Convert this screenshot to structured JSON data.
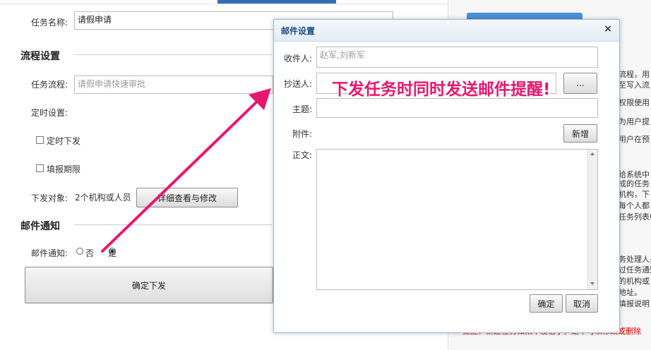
{
  "form": {
    "task_name_label": "任务名称:",
    "task_name_value": "请假申请",
    "process_section": "流程设置",
    "flow_label": "任务流程:",
    "flow_value": "请假申请快速审批",
    "timer_label": "定时设置:",
    "timed_dispatch_label": "定时下发",
    "deadline_label": "填报期限",
    "target_label": "下发对象:",
    "target_value": "2个机构或人员",
    "detail_button": "详细查看与修改",
    "email_section": "邮件通知",
    "email_notify_label": "邮件通知:",
    "radio_no": "否",
    "radio_yes": "是",
    "confirm_button": "确定下发"
  },
  "right_panel": {
    "lines": [
      "流程，用",
      "至写入流",
      "权限使用",
      "为用户提",
      "用户在预",
      "给系统中",
      "成的任务",
      "机构，下",
      "每个人都",
      "任务列表中",
      "务处理人员",
      "过任务通知",
      "的机构或",
      "地址。",
      "填报说明"
    ],
    "bottom_note": "提醒：新建任务如果不发信了，是不可以修改或删除"
  },
  "dialog": {
    "title": "邮件设置",
    "close": "×",
    "recipient_label": "收件人:",
    "recipient_value": "赵军,刘新军",
    "cc_label": "抄送人:",
    "cc_button": "...",
    "subject_label": "主题:",
    "attachment_label": "附件:",
    "add_button": "新增",
    "body_label": "正文:",
    "ok_button": "确定",
    "cancel_button": "取消"
  },
  "annotation": {
    "text": "下发任务时同时发送邮件提醒!",
    "color": "#e8166e"
  }
}
